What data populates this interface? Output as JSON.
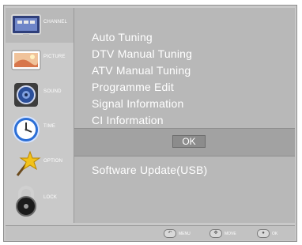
{
  "sidebar": {
    "items": [
      {
        "label": "CHANNEL",
        "icon": "tv-channel-icon",
        "active": true
      },
      {
        "label": "PICTURE",
        "icon": "picture-icon"
      },
      {
        "label": "SOUND",
        "icon": "speaker-icon"
      },
      {
        "label": "TIME",
        "icon": "clock-icon"
      },
      {
        "label": "OPTION",
        "icon": "star-wand-icon"
      },
      {
        "label": "LOCK",
        "icon": "lock-icon"
      }
    ]
  },
  "menu": {
    "items": [
      "Auto Tuning",
      "DTV Manual Tuning",
      "ATV Manual Tuning",
      "Programme Edit",
      "Signal Information",
      "CI Information"
    ],
    "ok_label": "OK",
    "software_update": "Software Update(USB)"
  },
  "bottombar": {
    "hints": [
      {
        "key": "back-button-icon",
        "label": "MENU"
      },
      {
        "key": "dpad-icon",
        "label": "MOVE"
      },
      {
        "key": "ok-button-icon",
        "label": "OK"
      }
    ]
  }
}
